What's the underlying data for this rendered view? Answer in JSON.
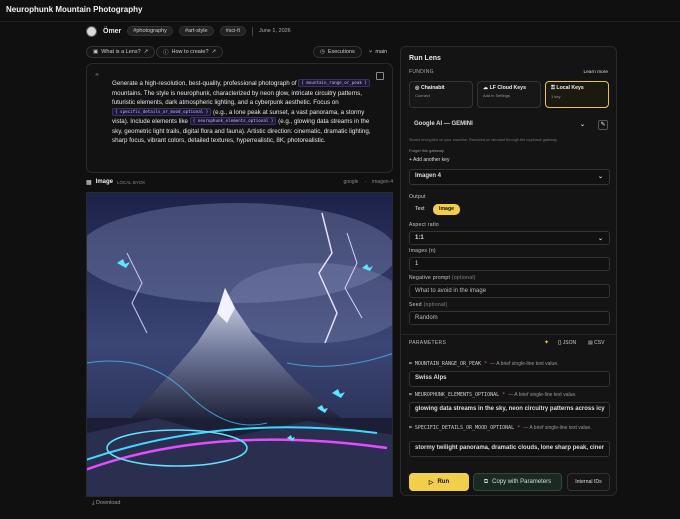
{
  "header": {
    "title": "Neurophunk Mountain Photography"
  },
  "author": {
    "name": "Ömer"
  },
  "tags": [
    "#photography",
    "#art-style",
    "#sci-fi"
  ],
  "date": "June 1, 2026",
  "pills": {
    "what_is_lens": "What is a Lens?",
    "how_to_create": "How to create?",
    "executions": "Executions",
    "branch": "main"
  },
  "prompt": {
    "p1": "Generate a high-resolution, best-quality, professional photograph of",
    "var1": "{ mountain_range_or_peak }",
    "p2": "mountains. The style is neurophunk, characterized by neon glow, intricate circuitry patterns, futuristic elements, dark atmospheric lighting, and a cyberpunk aesthetic. Focus on",
    "var2": "{ specific_details_or_mood_optional }",
    "p3": "(e.g., a lone peak at sunset, a vast panorama, a stormy vista). Include elements like",
    "var3": "{ neurophunk_elements_optional }",
    "p4": "(e.g., glowing data streams in the sky, geometric light trails, digital flora and fauna). Artistic direction: cinematic, dramatic lighting, sharp focus, vibrant colors, detailed textures, hyperrealistic, 8K, photorealistic."
  },
  "image_section": {
    "label": "Image",
    "sub": "LOCAL BYOK",
    "provider": "google",
    "model": "imagen-4",
    "download": "Download"
  },
  "lens": {
    "title": "Run Lens",
    "funding_label": "FUNDING",
    "learn_more": "Learn more",
    "cards": [
      {
        "title": "Chainabit",
        "sub": "Connect"
      },
      {
        "title": "LF Cloud Keys",
        "sub": "Add in Settings"
      },
      {
        "title": "Local Keys",
        "sub": "1 key"
      }
    ],
    "provider_select": "Google AI — GEMINI",
    "stored_note": "Stored encrypted on your machine. Resolved on demand through the loopback gateway.",
    "forget": "Forget this gateway",
    "add_key": "Add another key",
    "model_select": "Imagen 4",
    "output_label": "Output",
    "output_text": "Text",
    "output_image": "Image",
    "aspect_label": "Aspect ratio",
    "aspect_value": "1:1",
    "images_label": "Images (n)",
    "images_value": "1",
    "neg_label": "Negative prompt",
    "neg_optional": "(optional)",
    "neg_placeholder": "What to avoid in the image",
    "seed_label": "Seed",
    "seed_optional": "(optional)",
    "seed_placeholder": "Random",
    "params_label": "PARAMETERS",
    "json": "JSON",
    "csv": "CSV",
    "params": [
      {
        "name": "MOUNTAIN_RANGE_OR_PEAK",
        "desc": "— A brief single-line text value.",
        "value": "Swiss Alps"
      },
      {
        "name": "NEUROPHUNK_ELEMENTS_OPTIONAL",
        "desc": "— A brief single-line text value.",
        "value": "glowing data streams in the sky, neon circuitry patterns across icy"
      },
      {
        "name": "SPECIFIC_DETAILS_OR_MOOD_OPTIONAL",
        "desc": "— A brief single-line text value.",
        "value": "stormy twilight panorama, dramatic clouds, lone sharp peak, ciner"
      }
    ],
    "run": "Run",
    "copy": "Copy with Parameters",
    "internal": "Internal IDs"
  },
  "colors": {
    "accent": "#f2cf4a",
    "var_bg": "#1f1833",
    "var_text": "#c3b6ff"
  }
}
